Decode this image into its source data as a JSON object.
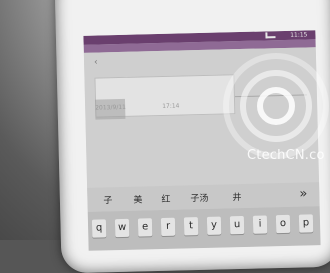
{
  "status_bar": {
    "time": "11:15"
  },
  "nav": {
    "back_symbol": "‹",
    "title": ""
  },
  "note": {
    "date": "2013/9/11",
    "time": "17:14"
  },
  "candidates": [
    "子",
    "美",
    "红",
    "子汤",
    "井"
  ],
  "candidate_more": "»",
  "keyboard_row": [
    "q",
    "w",
    "e",
    "r",
    "t",
    "y",
    "u",
    "i",
    "o",
    "p"
  ],
  "watermark": "CtechCN.co",
  "colors": {
    "status_bar": "#6a3f6e",
    "keyboard": "#bdbdbd",
    "candidate_bar": "#c8c8c8"
  }
}
